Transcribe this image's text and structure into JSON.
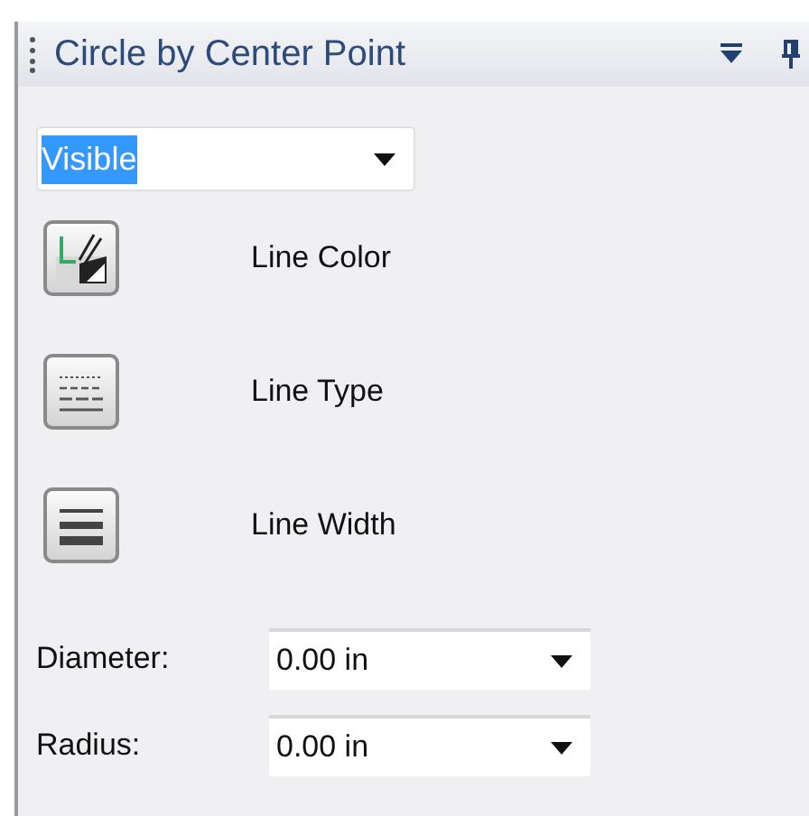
{
  "panel": {
    "title": "Circle by Center Point"
  },
  "visibility": {
    "value": "Visible",
    "highlighted": true
  },
  "style_buttons": [
    {
      "kind": "color",
      "label": "Line Color"
    },
    {
      "kind": "type",
      "label": "Line Type"
    },
    {
      "kind": "width",
      "label": "Line Width"
    }
  ],
  "fields": [
    {
      "label": "Diameter:",
      "value": "0.00 in"
    },
    {
      "label": "Radius:",
      "value": "0.00 in"
    }
  ]
}
